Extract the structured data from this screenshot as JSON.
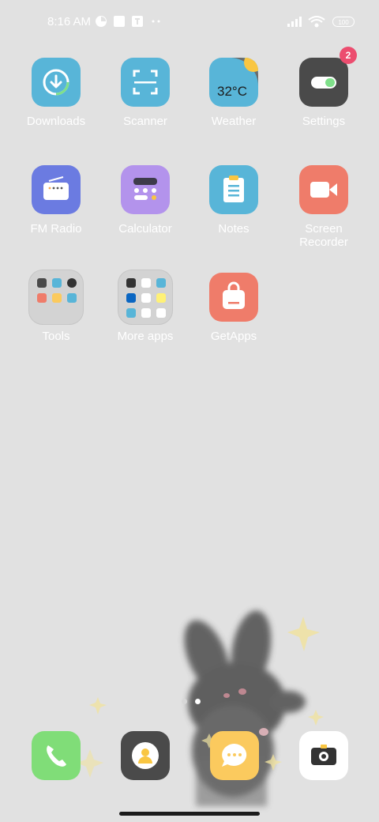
{
  "status_bar": {
    "time": "8:16 AM",
    "battery": "100",
    "icons": [
      "pie-icon",
      "square-icon",
      "notification-icon",
      "more-dots-icon",
      "signal-icon",
      "wifi-icon",
      "battery-icon"
    ]
  },
  "apps": [
    {
      "label": "Downloads",
      "color": "#58b5d8"
    },
    {
      "label": "Scanner",
      "color": "#58b5d8"
    },
    {
      "label": "Weather",
      "color": "#58b5d8",
      "temp": "32°C"
    },
    {
      "label": "Settings",
      "color": "#4a4a4a",
      "badge": "2"
    },
    {
      "label": "FM Radio",
      "color": "#6b7be1"
    },
    {
      "label": "Calculator",
      "color": "#b393ec"
    },
    {
      "label": "Notes",
      "color": "#58b5d8"
    },
    {
      "label": "Screen Recorder",
      "color": "#ef7c6a"
    },
    {
      "label": "Tools"
    },
    {
      "label": "More apps"
    },
    {
      "label": "GetApps",
      "color": "#ef7c6a"
    }
  ],
  "dock": [
    {
      "name": "Phone",
      "color": "#80dd78"
    },
    {
      "name": "Contacts",
      "color": "#4a4a4a"
    },
    {
      "name": "Messages",
      "color": "#fbca5e"
    },
    {
      "name": "Camera",
      "color": "#ffffff"
    }
  ],
  "page_indicator": {
    "count": 2,
    "active": 1
  }
}
